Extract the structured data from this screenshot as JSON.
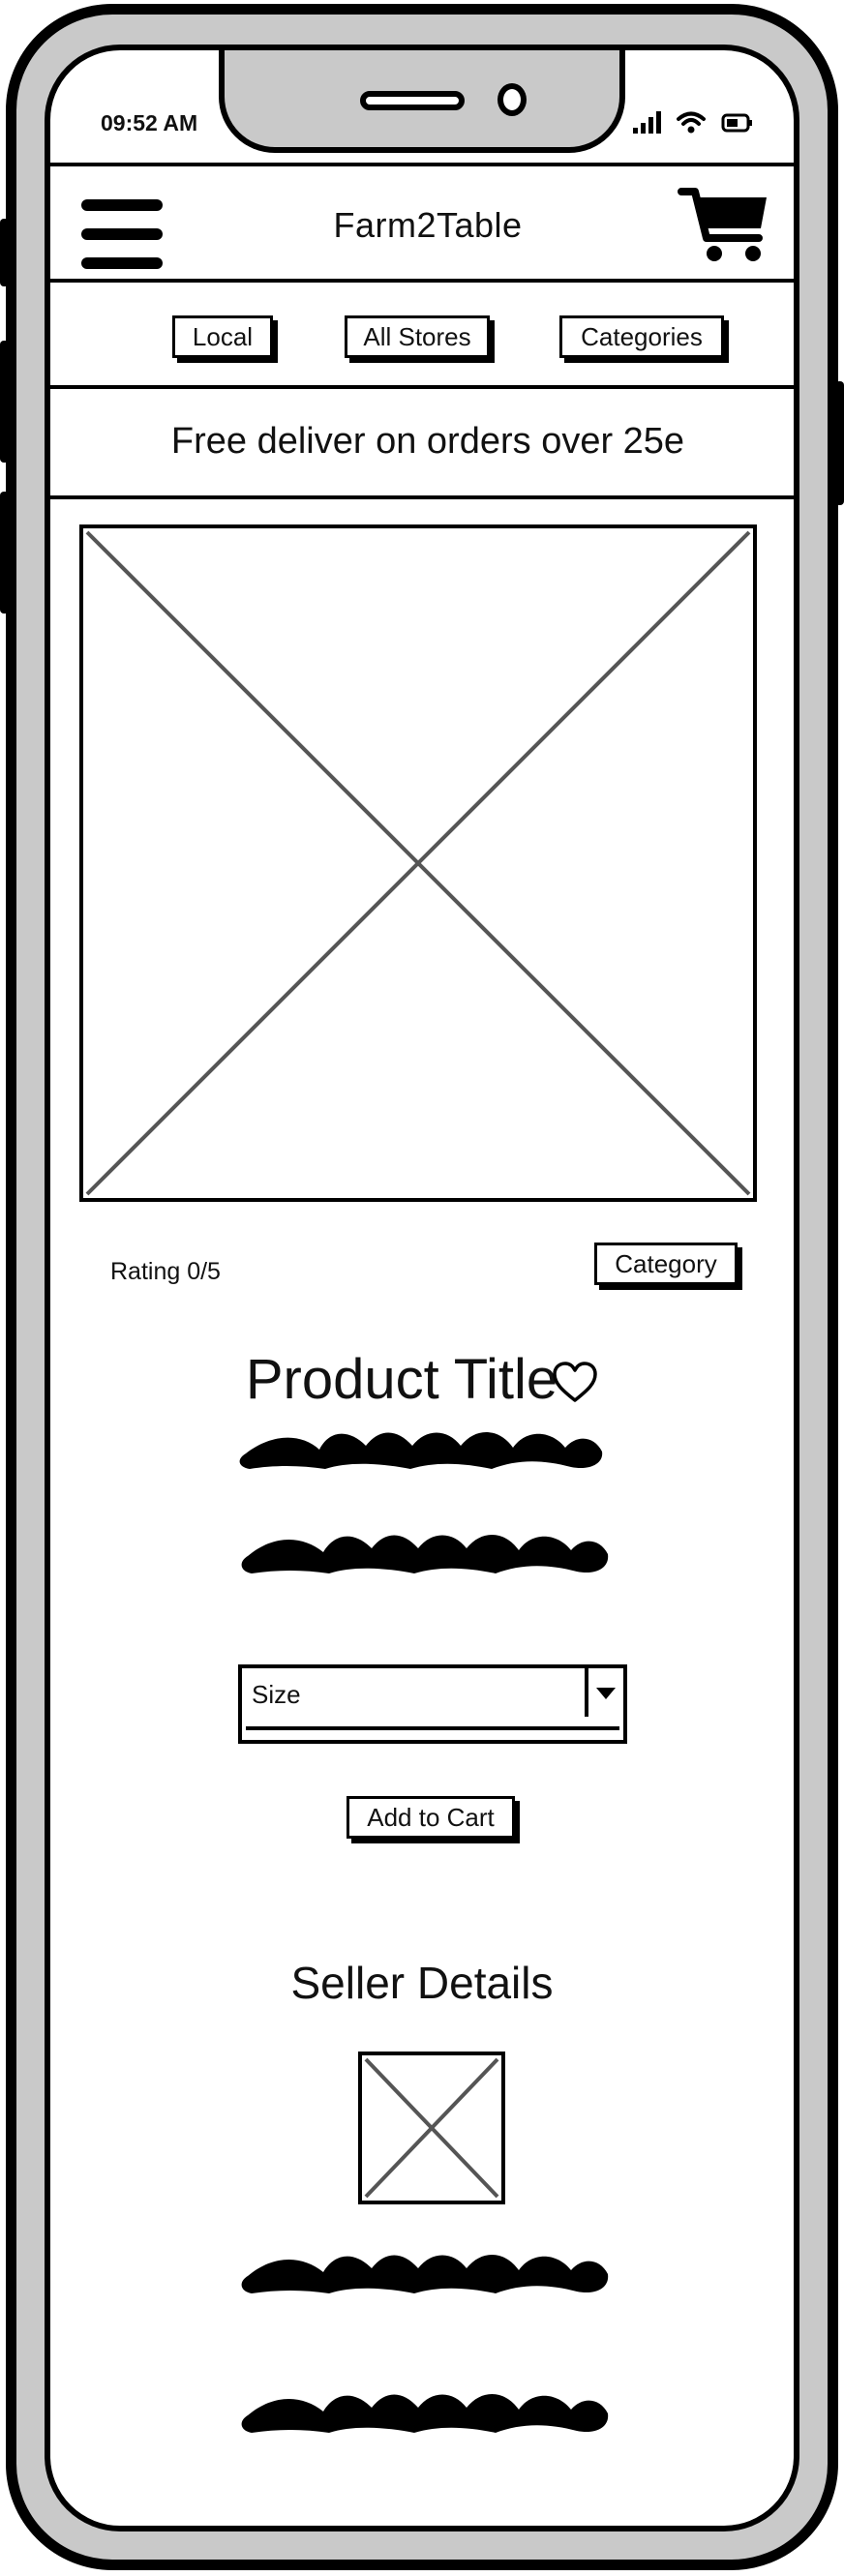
{
  "status_bar": {
    "time": "09:52 AM",
    "icons": [
      "signal-icon",
      "wifi-icon",
      "battery-icon"
    ]
  },
  "header": {
    "title": "Farm2Table",
    "menu_icon": "hamburger-menu-icon",
    "cart_icon": "shopping-cart-icon"
  },
  "nav": {
    "local": "Local",
    "all_stores": "All Stores",
    "categories": "Categories"
  },
  "promo": {
    "text": "Free deliver on orders over 25e"
  },
  "product": {
    "rating": "Rating 0/5",
    "category": "Category",
    "title": "Product Title",
    "favorite_icon": "heart-icon",
    "size_select": {
      "selected": "Size"
    },
    "add_to_cart": "Add to Cart"
  },
  "seller": {
    "heading": "Seller Details"
  }
}
